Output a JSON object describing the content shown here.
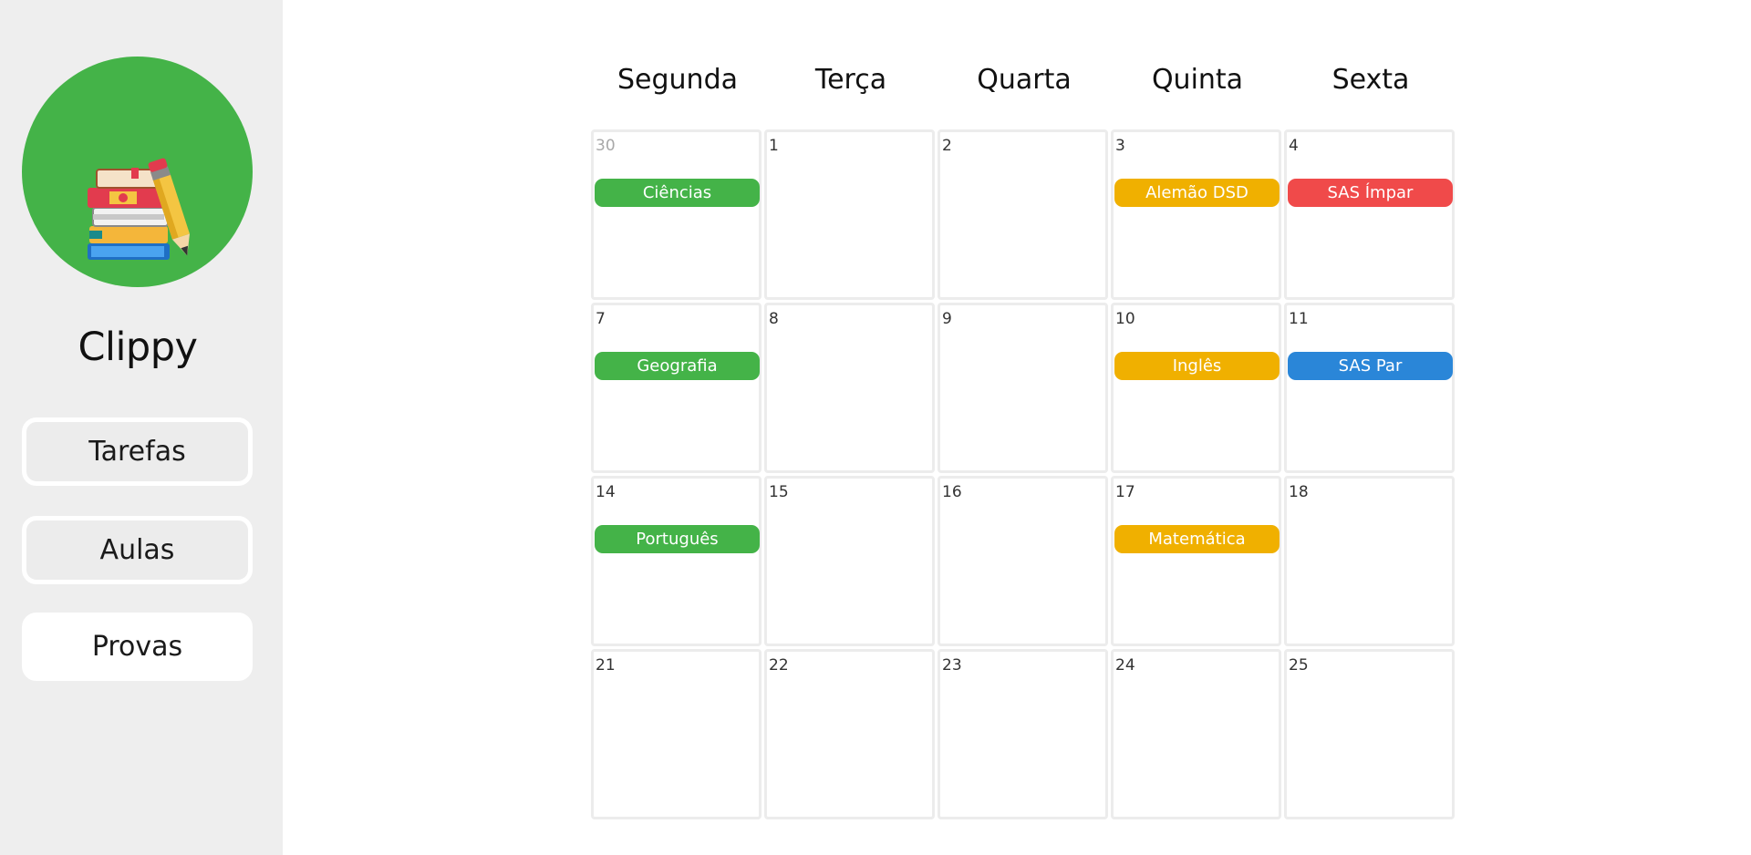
{
  "app": {
    "name": "Clippy"
  },
  "nav": [
    {
      "label": "Tarefas",
      "active": false
    },
    {
      "label": "Aulas",
      "active": false
    },
    {
      "label": "Provas",
      "active": true
    }
  ],
  "calendar": {
    "days": [
      "Segunda",
      "Terça",
      "Quarta",
      "Quinta",
      "Sexta"
    ],
    "weeks": [
      [
        {
          "day": "30",
          "other_month": true,
          "event": {
            "label": "Ciências",
            "color": "#44b348"
          }
        },
        {
          "day": "1"
        },
        {
          "day": "2"
        },
        {
          "day": "3",
          "event": {
            "label": "Alemão DSD",
            "color": "#f0b000"
          }
        },
        {
          "day": "4",
          "event": {
            "label": "SAS Ímpar",
            "color": "#f04a4a"
          }
        }
      ],
      [
        {
          "day": "7",
          "event": {
            "label": "Geografia",
            "color": "#44b348"
          }
        },
        {
          "day": "8"
        },
        {
          "day": "9"
        },
        {
          "day": "10",
          "event": {
            "label": "Inglês",
            "color": "#f0b000"
          }
        },
        {
          "day": "11",
          "event": {
            "label": "SAS Par",
            "color": "#2a86d8"
          }
        }
      ],
      [
        {
          "day": "14",
          "event": {
            "label": "Português",
            "color": "#44b348"
          }
        },
        {
          "day": "15"
        },
        {
          "day": "16"
        },
        {
          "day": "17",
          "event": {
            "label": "Matemática",
            "color": "#f0b000"
          }
        },
        {
          "day": "18"
        }
      ],
      [
        {
          "day": "21"
        },
        {
          "day": "22"
        },
        {
          "day": "23"
        },
        {
          "day": "24"
        },
        {
          "day": "25"
        }
      ]
    ]
  },
  "colors": {
    "sidebar_bg": "#eeeeee",
    "logo_bg": "#44b348",
    "green": "#44b348",
    "yellow": "#f0b000",
    "red": "#f04a4a",
    "blue": "#2a86d8"
  }
}
